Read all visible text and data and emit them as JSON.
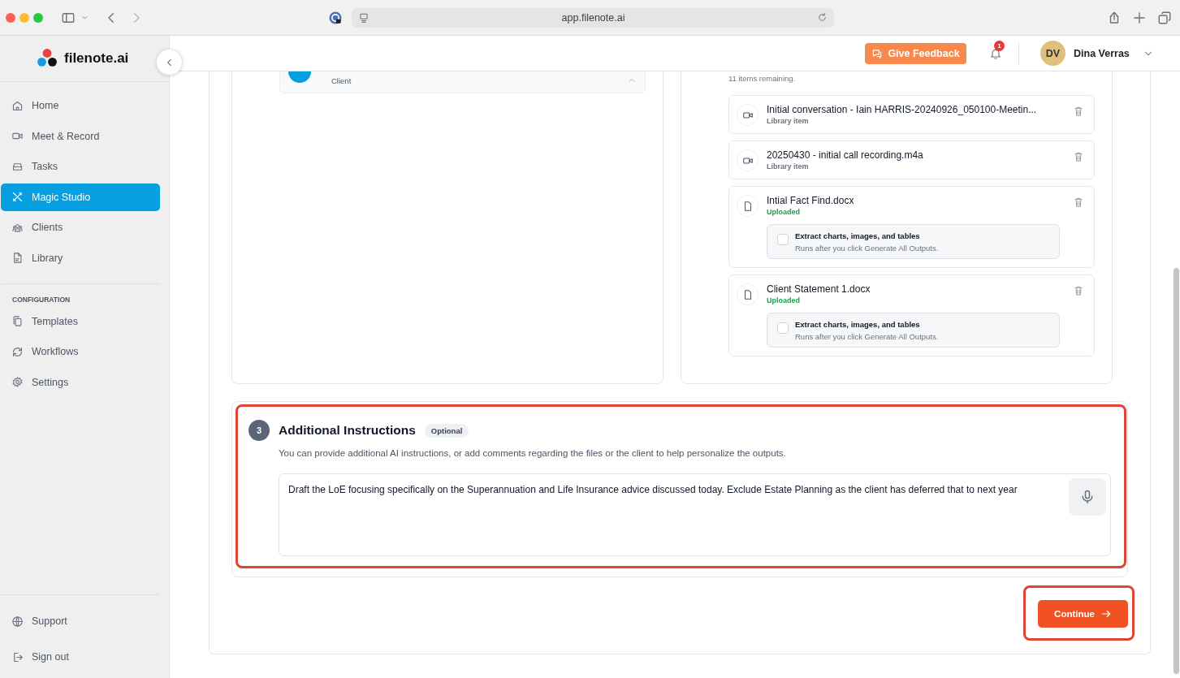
{
  "browser": {
    "url": "app.filenote.ai"
  },
  "sidebar": {
    "logo": "filenote.ai",
    "items": [
      {
        "label": "Home",
        "selected": false
      },
      {
        "label": "Meet & Record",
        "selected": false
      },
      {
        "label": "Tasks",
        "selected": false
      },
      {
        "label": "Magic Studio",
        "selected": true
      },
      {
        "label": "Clients",
        "selected": false
      },
      {
        "label": "Library",
        "selected": false
      }
    ],
    "config_heading": "CONFIGURATION",
    "config_items": [
      {
        "label": "Templates",
        "selected": false
      },
      {
        "label": "Workflows",
        "selected": false
      },
      {
        "label": "Settings",
        "selected": false
      }
    ],
    "bottom_items": [
      {
        "label": "Support",
        "selected": false
      },
      {
        "label": "Sign out",
        "selected": false
      }
    ]
  },
  "header": {
    "feedback_button": "Give Feedback",
    "notification_count": "1",
    "user": {
      "initials": "DV",
      "name": "Dina Verras"
    }
  },
  "client_chip": {
    "label": "Client"
  },
  "files": {
    "remaining": "11 items remaining.",
    "items": [
      {
        "kind": "video",
        "name": "Initial conversation - Iain HARRIS-20240926_050100-Meetin...",
        "status": "Library item",
        "color": "#6b7280"
      },
      {
        "kind": "video",
        "name": "20250430 - initial call recording.m4a",
        "status": "Library item",
        "color": "#6b7280"
      },
      {
        "kind": "document",
        "name": "Intial Fact Find.docx",
        "status": "Uploaded",
        "color": "#16a34a",
        "extract": {
          "label": "Extract charts, images, and tables",
          "hint": "Runs after you click Generate All Outputs.",
          "checked": false
        }
      },
      {
        "kind": "document",
        "name": "Client Statement 1.docx",
        "status": "Uploaded",
        "color": "#16a34a",
        "extract": {
          "label": "Extract charts, images, and tables",
          "hint": "Runs after you click Generate All Outputs.",
          "checked": false
        }
      }
    ]
  },
  "instructions": {
    "step": "3",
    "title": "Additional Instructions",
    "badge": "Optional",
    "description": "You can provide additional AI instructions, or add comments regarding the files or the client to help personalize the outputs.",
    "value": "Draft the LoE focusing specifically on the Superannuation and Life Insurance advice discussed today. Exclude Estate Planning as the client has deferred that to next year",
    "highlighted": true
  },
  "continue_button": {
    "label": "Continue",
    "highlighted": true
  }
}
